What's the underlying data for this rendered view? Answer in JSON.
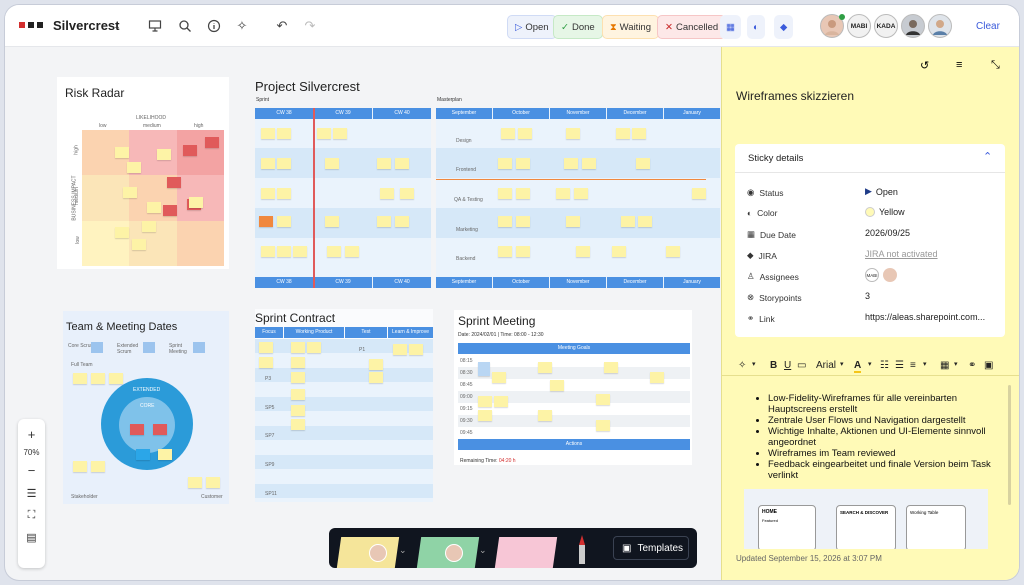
{
  "app": {
    "board_name": "Silvercrest"
  },
  "toolbar": {
    "undo": "↶",
    "redo": "↷"
  },
  "status_chips": [
    {
      "label": "Open",
      "icon": "play-icon",
      "bg": "#eef2fb",
      "color": "#3b5bdb"
    },
    {
      "label": "Done",
      "icon": "check-icon",
      "bg": "#e6f6e6",
      "color": "#2f9e44"
    },
    {
      "label": "Waiting",
      "icon": "hourglass-icon",
      "bg": "#fff4e0",
      "color": "#e67700"
    },
    {
      "label": "Cancelled",
      "icon": "x-icon",
      "bg": "#fde8e8",
      "color": "#c92a2a"
    }
  ],
  "avatars": [
    "MABI",
    "KADA"
  ],
  "clear_label": "Clear",
  "boards": {
    "risk": {
      "title": "Risk Radar",
      "likelihood": "LIKELIHOOD",
      "low": "low",
      "medium": "medium",
      "high": "high",
      "impact": "BUSINESS IMPACT",
      "ihigh": "high",
      "imedium": "medium",
      "ilow": "low"
    },
    "project": {
      "title": "Project Silvercrest",
      "sprint": "Sprint",
      "masterplan": "Masterplan",
      "cw": [
        "CW 38",
        "CW 39",
        "CW 40"
      ],
      "months": [
        "September",
        "October",
        "November",
        "December",
        "January"
      ],
      "rows": [
        "Design",
        "Frontend",
        "QA & Testing",
        "Marketing",
        "Backend"
      ],
      "sprint_rows": [
        "Design",
        "Frontend",
        "QA & Testing",
        "Marketing",
        "Backend"
      ]
    },
    "team": {
      "title": "Team & Meeting Dates",
      "core": "Core Scrum",
      "extended": "Extended Scrum",
      "sprint": "Sprint Meeting",
      "full": "Full Team",
      "ring_ext": "EXTENDED",
      "ring_core": "CORE",
      "stakeholder": "Stakeholder",
      "customer": "Customer"
    },
    "contract": {
      "title": "Sprint Contract",
      "cols": [
        "Focus Topics",
        "Working Product",
        "Test",
        "Learn & Improve"
      ],
      "rows": [
        "P1",
        "P2",
        "P3",
        "SP4",
        "SP5",
        "SP6",
        "SP7",
        "SP8",
        "SP9",
        "SP10",
        "SP11"
      ]
    },
    "meeting": {
      "title": "Sprint Meeting",
      "date": "Date: 2024/02/01 | Time: 08:00 - 12:30",
      "goals": "Meeting Goals",
      "actions": "Actions",
      "remaining_label": "Remaining Time:",
      "remaining_value": "04:20 h",
      "times": [
        "08:15",
        "08:30",
        "08:45",
        "09:00",
        "09:15",
        "09:30",
        "09:45"
      ]
    }
  },
  "zoom": {
    "plus": "+",
    "level": "70%",
    "minus": "−"
  },
  "dock": {
    "templates": "Templates"
  },
  "panel": {
    "title": "Wireframes skizzieren",
    "section": "Sticky details",
    "props": [
      {
        "label": "Status",
        "icon": "status-icon",
        "value": "Open"
      },
      {
        "label": "Color",
        "icon": "palette-icon",
        "value": "Yellow"
      },
      {
        "label": "Due Date",
        "icon": "calendar-icon",
        "value": "2026/09/25"
      },
      {
        "label": "JIRA",
        "icon": "jira-icon",
        "value": "JIRA not activated"
      },
      {
        "label": "Assignees",
        "icon": "user-icon",
        "value": "MABI"
      },
      {
        "label": "Storypoints",
        "icon": "storypoints-icon",
        "value": "3"
      },
      {
        "label": "Link",
        "icon": "link-icon",
        "value": "https://aleas.sharepoint.com..."
      }
    ],
    "font": "Arial",
    "bullets": [
      "Low-Fidelity-Wireframes für alle vereinbarten Hauptscreens erstellt",
      "Zentrale User Flows und Navigation dargestellt",
      "Wichtige Inhalte, Aktionen und UI-Elemente sinnvoll angeordnet",
      "Wireframes im Team reviewed",
      "Feedback eingearbeitet und finale Version beim Task verlinkt"
    ],
    "wire": {
      "home": "HOME",
      "featured": "Featured",
      "search": "SEARCH & DISCOVER",
      "working": "Working Table"
    },
    "updated": "Updated September 15, 2026 at 3:07 PM"
  }
}
